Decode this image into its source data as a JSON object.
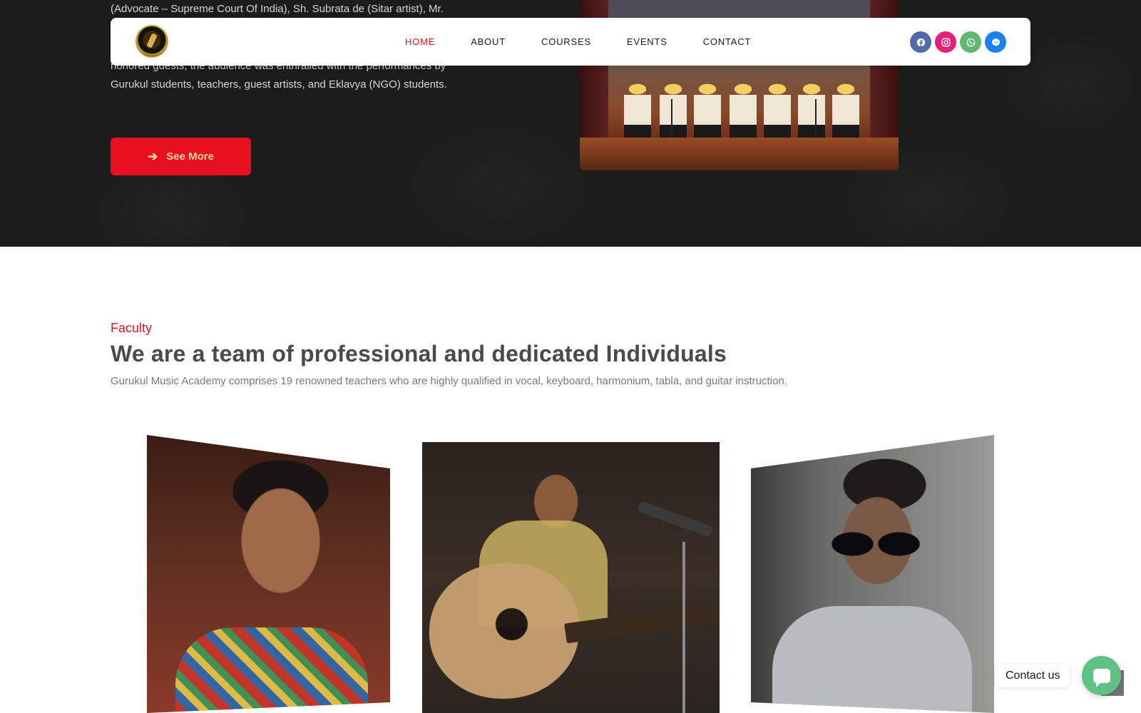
{
  "hero": {
    "line1": "(Advocate – Supreme Court Of India), Sh. Subrata de (Sitar artist), Mr.",
    "line2": "honored guests, the audience was enthralled with the performances by",
    "line3": "Gurukul students, teachers, guest artists, and Eklavya (NGO) students.",
    "cta_label": "See More"
  },
  "nav": {
    "links": [
      "HOME",
      "ABOUT",
      "COURSES",
      "EVENTS",
      "CONTACT"
    ],
    "active": "HOME",
    "socials": [
      {
        "icon": "facebook-icon",
        "color": "#4f6aa8"
      },
      {
        "icon": "instagram-icon",
        "color": "#e91e78"
      },
      {
        "icon": "whatsapp-icon",
        "color": "#5fb870"
      },
      {
        "icon": "messenger-icon",
        "color": "#1a82f0"
      }
    ]
  },
  "faculty": {
    "eyebrow": "Faculty",
    "title": "We are a team of professional and dedicated Individuals",
    "description": "Gurukul Music Academy comprises 19 renowned teachers who are highly qualified in vocal, keyboard, harmonium, tabla, and guitar instruction."
  },
  "contact_widget": {
    "label": "Contact us",
    "color": "#5fc183"
  },
  "colors": {
    "accent": "#e8101e",
    "hero_bg": "#1c1c1c"
  }
}
